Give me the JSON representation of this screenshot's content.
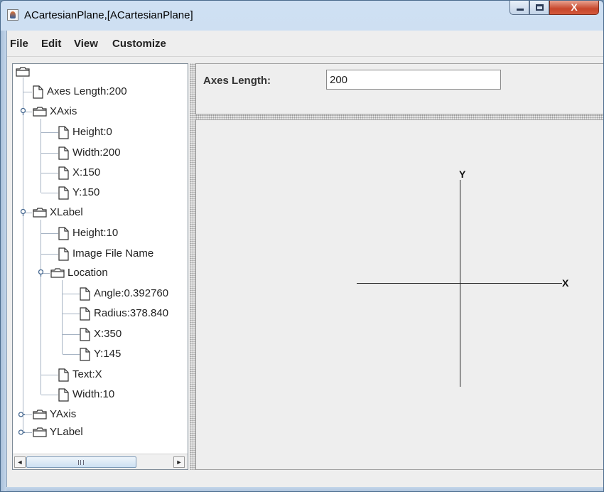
{
  "window": {
    "title": "ACartesianPlane,[ACartesianPlane]",
    "close_glyph": "X"
  },
  "menu": [
    "File",
    "Edit",
    "View",
    "Customize"
  ],
  "tree": {
    "root_label": "",
    "items": [
      {
        "label": "Axes Length:200"
      },
      {
        "label": "XAxis"
      },
      {
        "label": "Height:0"
      },
      {
        "label": "Width:200"
      },
      {
        "label": "X:150"
      },
      {
        "label": "Y:150"
      },
      {
        "label": "XLabel"
      },
      {
        "label": "Height:10"
      },
      {
        "label": "Image File Name"
      },
      {
        "label": "Location"
      },
      {
        "label": "Angle:0.392760"
      },
      {
        "label": "Radius:378.840"
      },
      {
        "label": "X:350"
      },
      {
        "label": "Y:145"
      },
      {
        "label": "Text:X"
      },
      {
        "label": "Width:10"
      },
      {
        "label": "YAxis"
      },
      {
        "label": "YLabel"
      }
    ]
  },
  "scrollbar": {
    "left_arrow": "◄",
    "right_arrow": "►"
  },
  "editor": {
    "label": "Axes Length:",
    "value": "200"
  },
  "plane": {
    "x_label": "X",
    "y_label": "Y",
    "axis_color": "#222222"
  },
  "colors": {
    "title_bar": "#c4d8ee",
    "panel_bg": "#eeeeee",
    "close_button": "#c7462c"
  }
}
